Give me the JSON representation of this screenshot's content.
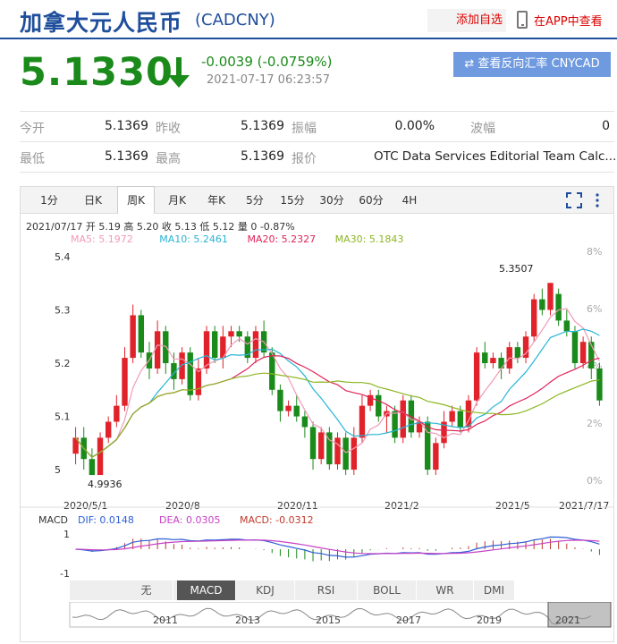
{
  "header": {
    "title": "加拿大元人民币",
    "code": "(CADCNY)",
    "add_fav": "添加自选",
    "app_link": "在APP中查看"
  },
  "quote": {
    "price": "5.1330",
    "change": "-0.0039 (-0.0759%)",
    "timestamp": "2021-07-17 06:23:57",
    "reverse_button": "⇄ 查看反向汇率 CNYCAD",
    "colors": {
      "down": "#1a8a1a",
      "up": "#e0232a",
      "accent": "#1f4e9c"
    }
  },
  "stats": {
    "rows": [
      [
        {
          "label": "今开",
          "value": "5.1369"
        },
        {
          "label": "昨收",
          "value": "5.1369"
        },
        {
          "label": "振幅",
          "value": "0.00%"
        },
        {
          "label": "波幅",
          "value": "0"
        }
      ],
      [
        {
          "label": "最低",
          "value": "5.1369"
        },
        {
          "label": "最高",
          "value": "5.1369"
        },
        {
          "label": "报价",
          "value": "OTC Data Services Editorial Team Calc..."
        }
      ]
    ]
  },
  "chart_tabs": [
    "1分",
    "日K",
    "周K",
    "月K",
    "年K",
    "5分",
    "15分",
    "30分",
    "60分",
    "4H"
  ],
  "active_tab": "周K",
  "info_line": "2021/07/17 开 5.19 高 5.20 收 5.13 低 5.12 量 0 -0.87%",
  "ma": [
    {
      "label": "MA5: 5.1972",
      "color": "#f19ab6"
    },
    {
      "label": "MA10: 5.2461",
      "color": "#27b5d6"
    },
    {
      "label": "MA20: 5.2327",
      "color": "#e0235a"
    },
    {
      "label": "MA30: 5.1843",
      "color": "#8db623"
    }
  ],
  "macd_info": {
    "name": "MACD",
    "dif": "DIF: 0.0148",
    "dea": "DEA: 0.0305",
    "macd": "MACD: -0.0312",
    "colors": {
      "dif": "#2e5fd6",
      "dea": "#c742c7",
      "macd": "#c0392b"
    }
  },
  "indicator_tabs": [
    "无",
    "MACD",
    "KDJ",
    "RSI",
    "BOLL",
    "WR",
    "DMI"
  ],
  "active_indicator": "MACD",
  "timeline_labels": [
    "2011",
    "2013",
    "2015",
    "2017",
    "2019",
    "2021"
  ],
  "chart_data": {
    "type": "candlestick",
    "y_ticks": [
      "5",
      "5.1",
      "5.2",
      "5.3",
      "5.4"
    ],
    "right_ticks": [
      "0%",
      "2%",
      "4%",
      "6%",
      "8%"
    ],
    "x_labels": [
      "2020/5/1",
      "2020/8",
      "2020/11",
      "2021/2",
      "2021/5",
      "2021/7/17"
    ],
    "ylim": [
      4.98,
      5.41
    ],
    "max_annotation": "5.3507",
    "min_annotation": "4.9936",
    "macd_ticks": [
      "1",
      "-1"
    ],
    "candles": [
      [
        5.03,
        5.06,
        5.08,
        5.01
      ],
      [
        5.06,
        5.02,
        5.08,
        5.0
      ],
      [
        5.02,
        4.99,
        5.04,
        4.9936
      ],
      [
        4.99,
        5.06,
        5.07,
        4.99
      ],
      [
        5.06,
        5.09,
        5.1,
        5.05
      ],
      [
        5.09,
        5.12,
        5.14,
        5.08
      ],
      [
        5.12,
        5.21,
        5.23,
        5.11
      ],
      [
        5.21,
        5.29,
        5.31,
        5.2
      ],
      [
        5.29,
        5.22,
        5.3,
        5.21
      ],
      [
        5.22,
        5.19,
        5.24,
        5.17
      ],
      [
        5.19,
        5.26,
        5.28,
        5.18
      ],
      [
        5.26,
        5.2,
        5.27,
        5.18
      ],
      [
        5.2,
        5.17,
        5.22,
        5.15
      ],
      [
        5.17,
        5.22,
        5.23,
        5.16
      ],
      [
        5.22,
        5.14,
        5.23,
        5.13
      ],
      [
        5.14,
        5.19,
        5.21,
        5.13
      ],
      [
        5.19,
        5.26,
        5.27,
        5.18
      ],
      [
        5.26,
        5.21,
        5.27,
        5.2
      ],
      [
        5.21,
        5.25,
        5.27,
        5.19
      ],
      [
        5.25,
        5.26,
        5.27,
        5.23
      ],
      [
        5.26,
        5.25,
        5.27,
        5.24
      ],
      [
        5.25,
        5.21,
        5.26,
        5.2
      ],
      [
        5.21,
        5.26,
        5.27,
        5.2
      ],
      [
        5.26,
        5.22,
        5.28,
        5.21
      ],
      [
        5.22,
        5.15,
        5.23,
        5.14
      ],
      [
        5.15,
        5.11,
        5.16,
        5.09
      ],
      [
        5.11,
        5.12,
        5.13,
        5.1
      ],
      [
        5.12,
        5.1,
        5.14,
        5.09
      ],
      [
        5.1,
        5.08,
        5.11,
        5.06
      ],
      [
        5.08,
        5.02,
        5.09,
        5.0
      ],
      [
        5.02,
        5.07,
        5.08,
        5.01
      ],
      [
        5.07,
        5.01,
        5.08,
        5.0
      ],
      [
        5.01,
        5.06,
        5.07,
        5.0
      ],
      [
        5.06,
        5.0,
        5.07,
        4.99
      ],
      [
        5.0,
        5.06,
        5.08,
        4.99
      ],
      [
        5.06,
        5.12,
        5.14,
        5.05
      ],
      [
        5.12,
        5.14,
        5.15,
        5.11
      ],
      [
        5.14,
        5.1,
        5.15,
        5.09
      ],
      [
        5.1,
        5.11,
        5.12,
        5.07
      ],
      [
        5.11,
        5.06,
        5.12,
        5.05
      ],
      [
        5.06,
        5.13,
        5.14,
        5.05
      ],
      [
        5.13,
        5.07,
        5.14,
        5.06
      ],
      [
        5.07,
        5.09,
        5.1,
        5.06
      ],
      [
        5.09,
        5.0,
        5.1,
        4.99
      ],
      [
        5.0,
        5.05,
        5.06,
        4.99
      ],
      [
        5.05,
        5.09,
        5.11,
        5.04
      ],
      [
        5.09,
        5.11,
        5.12,
        5.08
      ],
      [
        5.11,
        5.08,
        5.12,
        5.07
      ],
      [
        5.08,
        5.13,
        5.14,
        5.07
      ],
      [
        5.13,
        5.22,
        5.23,
        5.12
      ],
      [
        5.22,
        5.2,
        5.24,
        5.19
      ],
      [
        5.2,
        5.21,
        5.22,
        5.19
      ],
      [
        5.21,
        5.19,
        5.22,
        5.17
      ],
      [
        5.19,
        5.23,
        5.24,
        5.18
      ],
      [
        5.23,
        5.21,
        5.24,
        5.2
      ],
      [
        5.21,
        5.25,
        5.26,
        5.2
      ],
      [
        5.25,
        5.32,
        5.33,
        5.24
      ],
      [
        5.32,
        5.3,
        5.34,
        5.29
      ],
      [
        5.3,
        5.3507,
        5.3507,
        5.29
      ],
      [
        5.33,
        5.28,
        5.34,
        5.27
      ],
      [
        5.28,
        5.26,
        5.3,
        5.25
      ],
      [
        5.26,
        5.2,
        5.27,
        5.19
      ],
      [
        5.2,
        5.24,
        5.25,
        5.19
      ],
      [
        5.24,
        5.19,
        5.25,
        5.17
      ],
      [
        5.19,
        5.13,
        5.2,
        5.12
      ]
    ]
  }
}
